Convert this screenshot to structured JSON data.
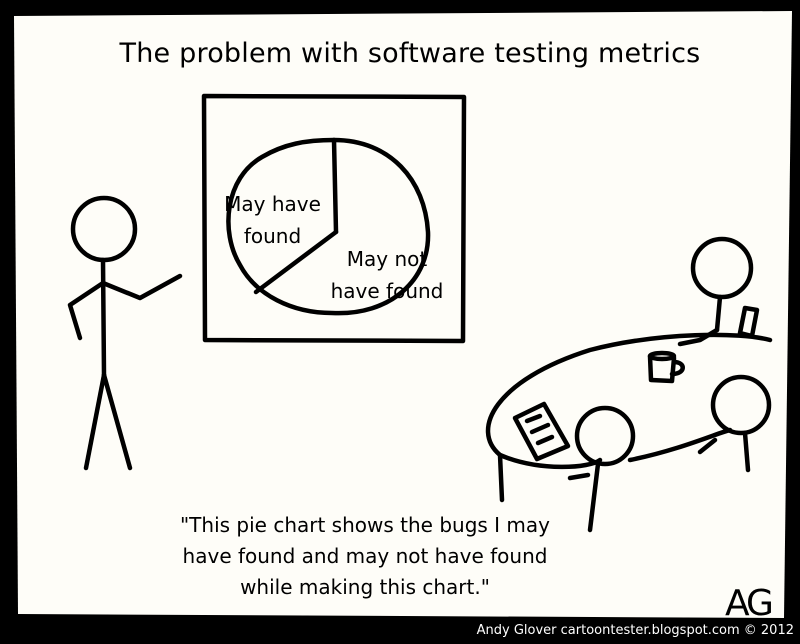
{
  "title": "The problem with software testing metrics",
  "pie_labels": {
    "found_line1": "May have",
    "found_line2": "found",
    "not_found_line1": "May not",
    "not_found_line2": "have found"
  },
  "caption": {
    "line1": "\"This pie chart shows the bugs I may",
    "line2": "have found and may not have found",
    "line3": "while making this chart.\""
  },
  "signature": "AG",
  "credit": "Andy Glover cartoontester.blogspot.com © 2012",
  "colors": {
    "background": "#000000",
    "panel": "#fefdf8",
    "ink": "#000000"
  }
}
